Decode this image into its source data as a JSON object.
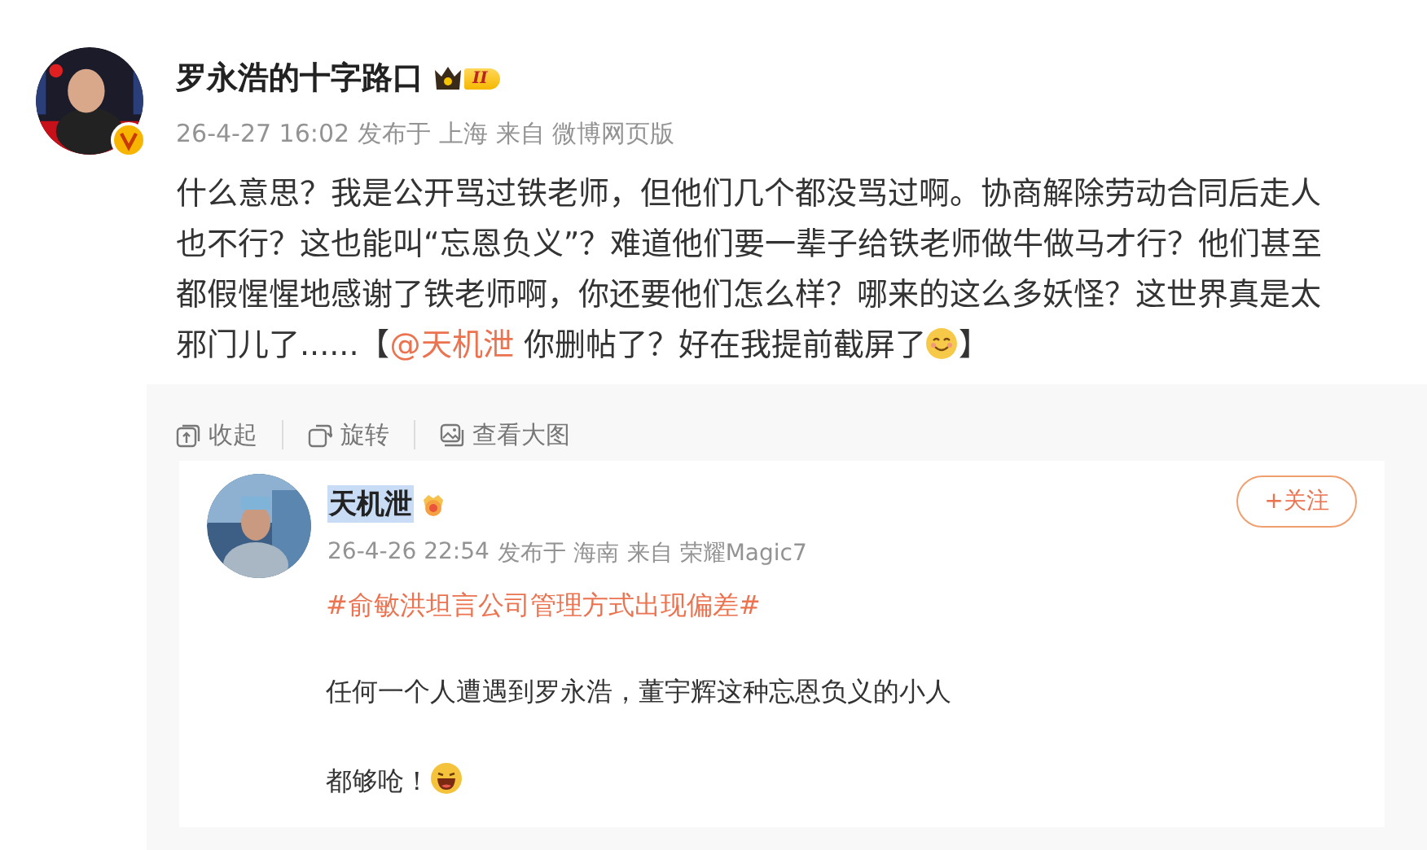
{
  "post": {
    "author": {
      "name": "罗永浩的十字路口",
      "level_badge": "II",
      "verified": true
    },
    "meta": [
      "26-4-27 16:02",
      "发布于 上海",
      "来自 微博网页版"
    ],
    "text": [
      {
        "kind": "text",
        "text": "什么意思？我是公开骂过铁老师，但他们几个都没骂过啊。协商解除劳动合同后走人也不行？这也能叫“忘恩负义”？难道他们要一辈子给铁老师做牛做马才行？他们甚至都假惺惺地感谢了铁老师啊，你还要他们怎么样？哪来的这么多妖怪？这世界真是太邪门儿了......【"
      },
      {
        "kind": "mention",
        "text": "@天机泄"
      },
      {
        "kind": "text",
        "text": " 你删帖了？好在我提前截屏了"
      },
      {
        "kind": "smile"
      },
      {
        "kind": "text",
        "text": "】"
      }
    ],
    "actions": [
      {
        "kind": "collapse",
        "label": "收起"
      },
      {
        "kind": "rotate",
        "label": "旋转"
      },
      {
        "kind": "view",
        "label": "查看大图"
      }
    ],
    "screenshot": {
      "author": {
        "name": "天机泄",
        "highlighted": true
      },
      "meta": [
        "26-4-26 22:54",
        "发布于 海南",
        "来自 荣耀Magic7"
      ],
      "follow_button": "+关注",
      "topic": "#俞敏洪坦言公司管理方式出现偏差#",
      "paragraphs": [
        [
          {
            "kind": "text",
            "text": "任何一个人遭遇到罗永浩，董宇辉这种忘恩负义的小人"
          }
        ],
        [
          {
            "kind": "text",
            "text": "都够呛！"
          },
          {
            "kind": "laugh"
          }
        ]
      ]
    }
  }
}
